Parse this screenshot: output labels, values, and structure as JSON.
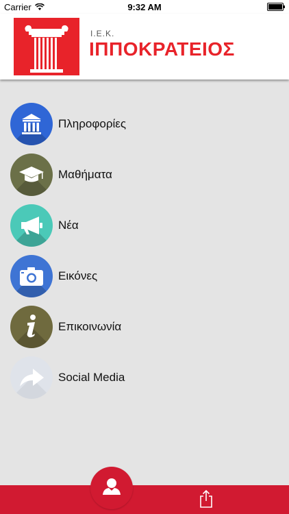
{
  "status": {
    "carrier": "Carrier",
    "time": "9:32 AM"
  },
  "header": {
    "logo_tag": "Ι.Ε.Κ.",
    "logo_name": "ΙΠΠΟΚΡΑΤΕΙΟΣ"
  },
  "menu": {
    "items": [
      {
        "label": "Πληροφορίες",
        "icon": "institution-icon",
        "color": "#2f66d6"
      },
      {
        "label": "Μαθήματα",
        "icon": "graduation-cap-icon",
        "color": "#6b7048"
      },
      {
        "label": "Νέα",
        "icon": "megaphone-icon",
        "color": "#4bc9b8"
      },
      {
        "label": "Εικόνες",
        "icon": "camera-icon",
        "color": "#3e74d4"
      },
      {
        "label": "Επικοινωνία",
        "icon": "info-icon",
        "color": "#6f6a3e"
      },
      {
        "label": "Social Media",
        "icon": "share-arrow-icon",
        "color": "#dfe3ea"
      }
    ]
  },
  "tabbar": {
    "accent": "#d11a31"
  }
}
